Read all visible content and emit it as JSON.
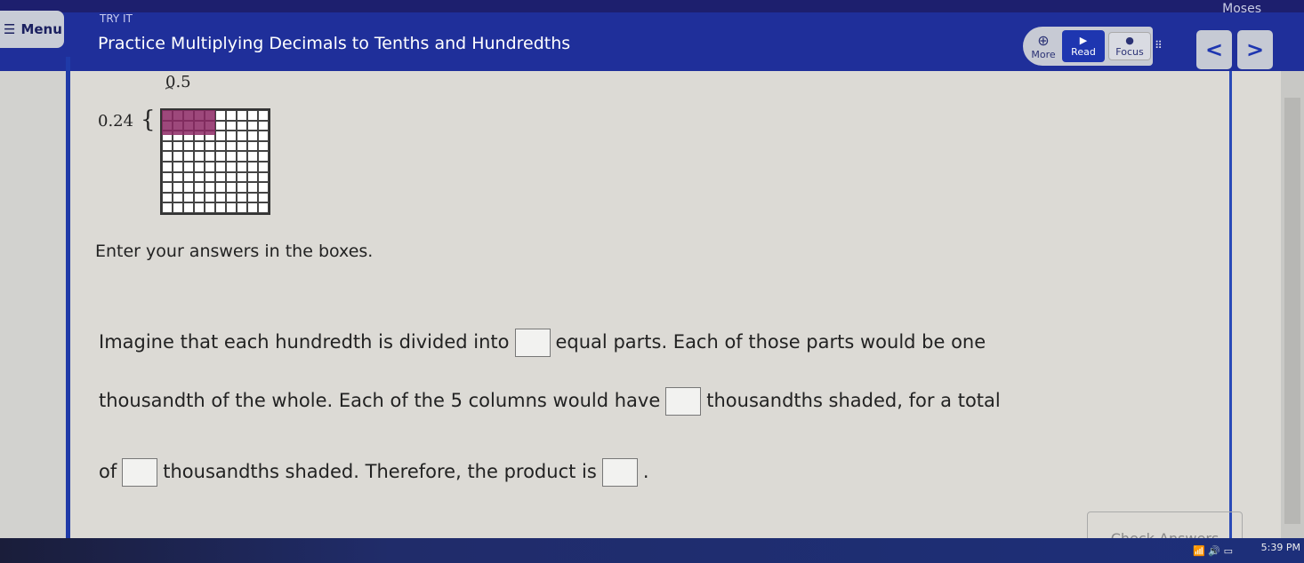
{
  "header": {
    "user": "Moses",
    "menu_label": "Menu",
    "eyebrow": "TRY IT",
    "title": "Practice Multiplying Decimals to Tenths and Hundredths",
    "tools": {
      "more": "More",
      "read": "Read",
      "focus": "Focus"
    },
    "prev": "<",
    "next": ">"
  },
  "model": {
    "top_label": "0.5",
    "side_label": "0.24",
    "grid_rows": 10,
    "grid_cols": 10,
    "shaded_cols": 5,
    "shaded_rows": 2.4,
    "shade_color": "#8c2864"
  },
  "instructions": "Enter your answers in the boxes.",
  "question": {
    "p1a": "Imagine that each hundredth is divided into",
    "p1b": "equal parts. Each of those parts would be one",
    "p2a": "thousandth of the whole. Each of the 5 columns would have",
    "p2b": "thousandths shaded, for a total",
    "p3a": "of",
    "p3b": "thousandths shaded. Therefore, the product is",
    "p3c": "."
  },
  "check_label": "Check Answers",
  "taskbar": {
    "time": "5:39 PM"
  }
}
